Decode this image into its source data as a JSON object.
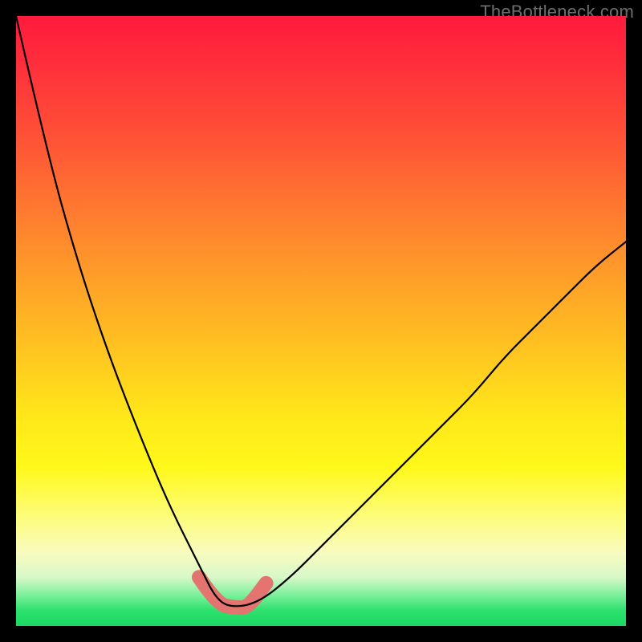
{
  "watermark": "TheBottleneck.com",
  "colors": {
    "bg": "#000000",
    "curve": "#000000",
    "valley": "#e4746f",
    "gradient_top": "#ff1a3c",
    "gradient_bottom": "#19d862"
  },
  "chart_data": {
    "type": "line",
    "title": "",
    "xlabel": "",
    "ylabel": "",
    "xlim": [
      0,
      100
    ],
    "ylim": [
      0,
      100
    ],
    "note": "No tick labels or axis text are rendered in the image; values are visual estimates on a 0–100 normalized scale where y is 'distance from top'. Lower y = worse (red), higher y (near bottom) = better (green). The black curve has a deep minimum-bottleneck valley around x≈32–41.",
    "series": [
      {
        "name": "bottleneck-curve",
        "x": [
          0,
          5,
          10,
          15,
          20,
          25,
          30,
          33,
          36,
          40,
          45,
          50,
          55,
          60,
          65,
          70,
          75,
          80,
          85,
          90,
          95,
          100
        ],
        "y": [
          0,
          22,
          40,
          55,
          68,
          80,
          90,
          96,
          97,
          96,
          92,
          87,
          82,
          77,
          72,
          67,
          62,
          56,
          51,
          46,
          41,
          37
        ]
      },
      {
        "name": "valley-highlight",
        "x": [
          30,
          33,
          36,
          38,
          41
        ],
        "y": [
          92,
          96.5,
          97,
          97,
          93
        ]
      }
    ]
  }
}
